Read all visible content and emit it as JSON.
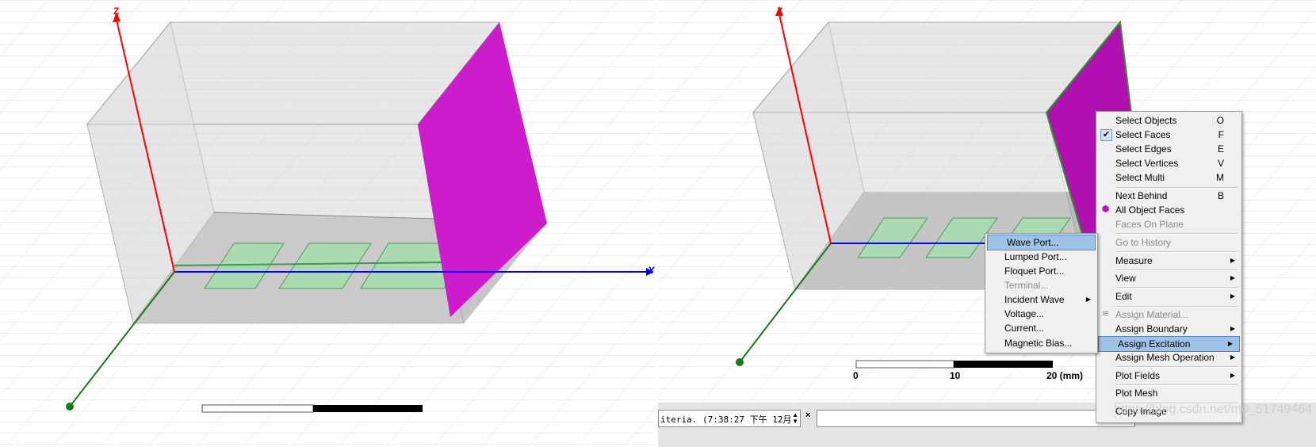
{
  "left_view": {
    "axis_z": "Z",
    "axis_y": "Y",
    "colors": {
      "port_face": "#cc1ccc",
      "patch": "#a8dcb0",
      "x_axis": "#1a7a1a",
      "y_axis": "#0000ff",
      "z_axis": "#ff0000"
    }
  },
  "right_view": {
    "axis_z": "Z",
    "scale": {
      "t0": "0",
      "t10": "10",
      "t20": "20 (mm)"
    }
  },
  "context_menu": {
    "items": [
      {
        "label": "Select Objects",
        "shortcut": "O"
      },
      {
        "label": "Select Faces",
        "shortcut": "F",
        "checked": true
      },
      {
        "label": "Select Edges",
        "shortcut": "E"
      },
      {
        "label": "Select Vertices",
        "shortcut": "V"
      },
      {
        "label": "Select Multi",
        "shortcut": "M"
      },
      {
        "label": "Next Behind",
        "shortcut": "B"
      },
      {
        "label": "All Object Faces",
        "icon": "face-cube-icon"
      },
      {
        "label": "Faces On Plane",
        "disabled": true
      },
      {
        "label": "Go to History",
        "disabled": true
      },
      {
        "label": "Measure",
        "submenu": true
      },
      {
        "label": "View",
        "submenu": true
      },
      {
        "label": "Edit",
        "submenu": true
      },
      {
        "label": "Assign Material...",
        "disabled": true,
        "icon": "material-icon"
      },
      {
        "label": "Assign Boundary",
        "submenu": true
      },
      {
        "label": "Assign Excitation",
        "submenu": true,
        "highlighted": true
      },
      {
        "label": "Assign Mesh Operation",
        "submenu": true
      },
      {
        "label": "Plot Fields",
        "submenu": true
      },
      {
        "label": "Plot Mesh"
      },
      {
        "label": "Copy Image"
      }
    ]
  },
  "excitation_submenu": {
    "items": [
      {
        "label": "Wave Port...",
        "highlighted": true
      },
      {
        "label": "Lumped Port..."
      },
      {
        "label": "Floquet Port..."
      },
      {
        "label": "Terminal...",
        "disabled": true
      },
      {
        "label": "Incident Wave",
        "submenu": true
      },
      {
        "label": "Voltage..."
      },
      {
        "label": "Current..."
      },
      {
        "label": "Magnetic Bias..."
      }
    ]
  },
  "status": {
    "message": "iteria. (7:38:27 下午  12月"
  },
  "watermark": "https://blog.csdn.net/m0_51749464"
}
